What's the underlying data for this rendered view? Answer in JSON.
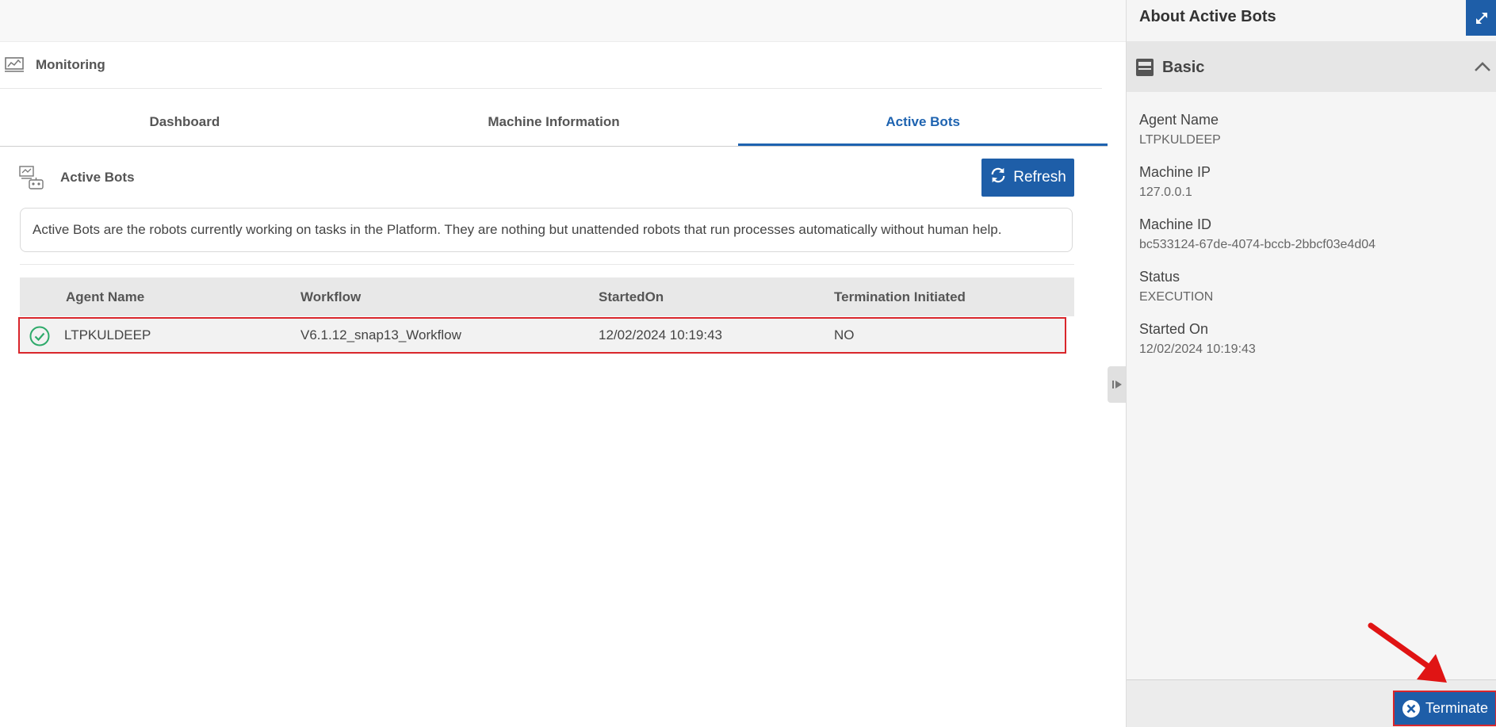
{
  "header": {
    "title": "Monitoring"
  },
  "tabs": [
    {
      "label": "Dashboard",
      "active": false
    },
    {
      "label": "Machine Information",
      "active": false
    },
    {
      "label": "Active Bots",
      "active": true
    }
  ],
  "section": {
    "title": "Active Bots",
    "refresh_label": "Refresh",
    "description": "Active Bots are the robots currently working on tasks in the Platform. They are nothing but unattended robots that run processes automatically without human help."
  },
  "table": {
    "columns": [
      "Agent Name",
      "Workflow",
      "StartedOn",
      "Termination Initiated"
    ],
    "rows": [
      {
        "agent": "LTPKULDEEP",
        "workflow": "V6.1.12_snap13_Workflow",
        "started": "12/02/2024 10:19:43",
        "termination": "NO",
        "status_icon": "check-circle-icon"
      }
    ]
  },
  "panel": {
    "title": "About Active Bots",
    "section_label": "Basic",
    "fields": [
      {
        "label": "Agent Name",
        "value": "LTPKULDEEP"
      },
      {
        "label": "Machine IP",
        "value": "127.0.0.1"
      },
      {
        "label": "Machine ID",
        "value": "bc533124-67de-4074-bccb-2bbcf03e4d04"
      },
      {
        "label": "Status",
        "value": "EXECUTION"
      },
      {
        "label": "Started On",
        "value": "12/02/2024 10:19:43"
      }
    ],
    "terminate_label": "Terminate"
  },
  "colors": {
    "accent": "#1e5ea8",
    "highlight": "#d9262b",
    "success": "#2eaa6a"
  }
}
